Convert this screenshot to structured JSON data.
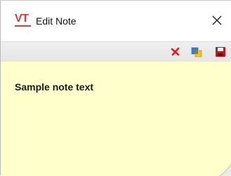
{
  "window": {
    "title": "Edit Note",
    "app_logo_text": "VT"
  },
  "toolbar": {
    "buttons": [
      {
        "name": "delete",
        "icon": "red-x-icon"
      },
      {
        "name": "color",
        "icon": "color-palette-icon"
      },
      {
        "name": "save",
        "icon": "save-floppy-icon"
      }
    ]
  },
  "note": {
    "text": "Sample note text",
    "background_color": "#ffffcc"
  },
  "colors": {
    "logo": "#d93a3a",
    "toolbar": "#ebebeb",
    "note_background": "#ffffcc"
  }
}
